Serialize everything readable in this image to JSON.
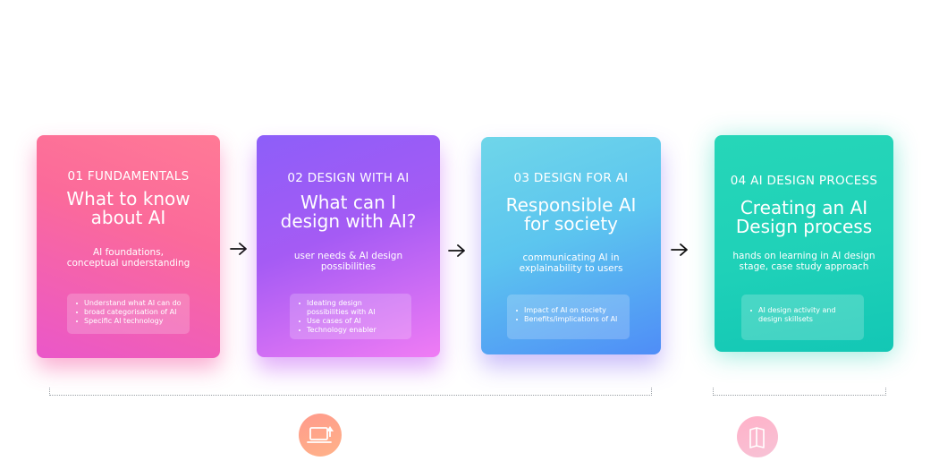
{
  "cards": [
    {
      "label": "01 FUNDAMENTALS",
      "title_line1": "What to know",
      "title_line2": "about AI",
      "desc_line1": "AI foundations,",
      "desc_line2": "conceptual understanding",
      "bullets": [
        "Understand what AI can do",
        "broad categorisation of AI",
        "Specific AI technology"
      ]
    },
    {
      "label": "02 DESIGN WITH AI",
      "title_line1": "What can I",
      "title_line2": "design with AI?",
      "desc_line1": "user needs & AI design",
      "desc_line2": "possibilities",
      "bullets": [
        "Ideating design possibilities with AI",
        "Use cases of AI",
        "Technology enabler"
      ]
    },
    {
      "label": "03 DESIGN FOR AI",
      "title_line1": "Responsible AI",
      "title_line2": "for society",
      "desc_line1": "communicating AI in",
      "desc_line2": "explainability to users",
      "bullets": [
        "Impact of AI on society",
        "Benefits/implications of AI"
      ]
    },
    {
      "label": "04 AI DESIGN PROCESS",
      "title_line1": "Creating an AI",
      "title_line2": "Design process",
      "desc_line1": "hands on learning in AI design",
      "desc_line2": "stage, case study approach",
      "bullets": [
        "AI design activity and design skillsets"
      ]
    }
  ],
  "icons": [
    "laptop-upload-icon",
    "book-icon"
  ]
}
